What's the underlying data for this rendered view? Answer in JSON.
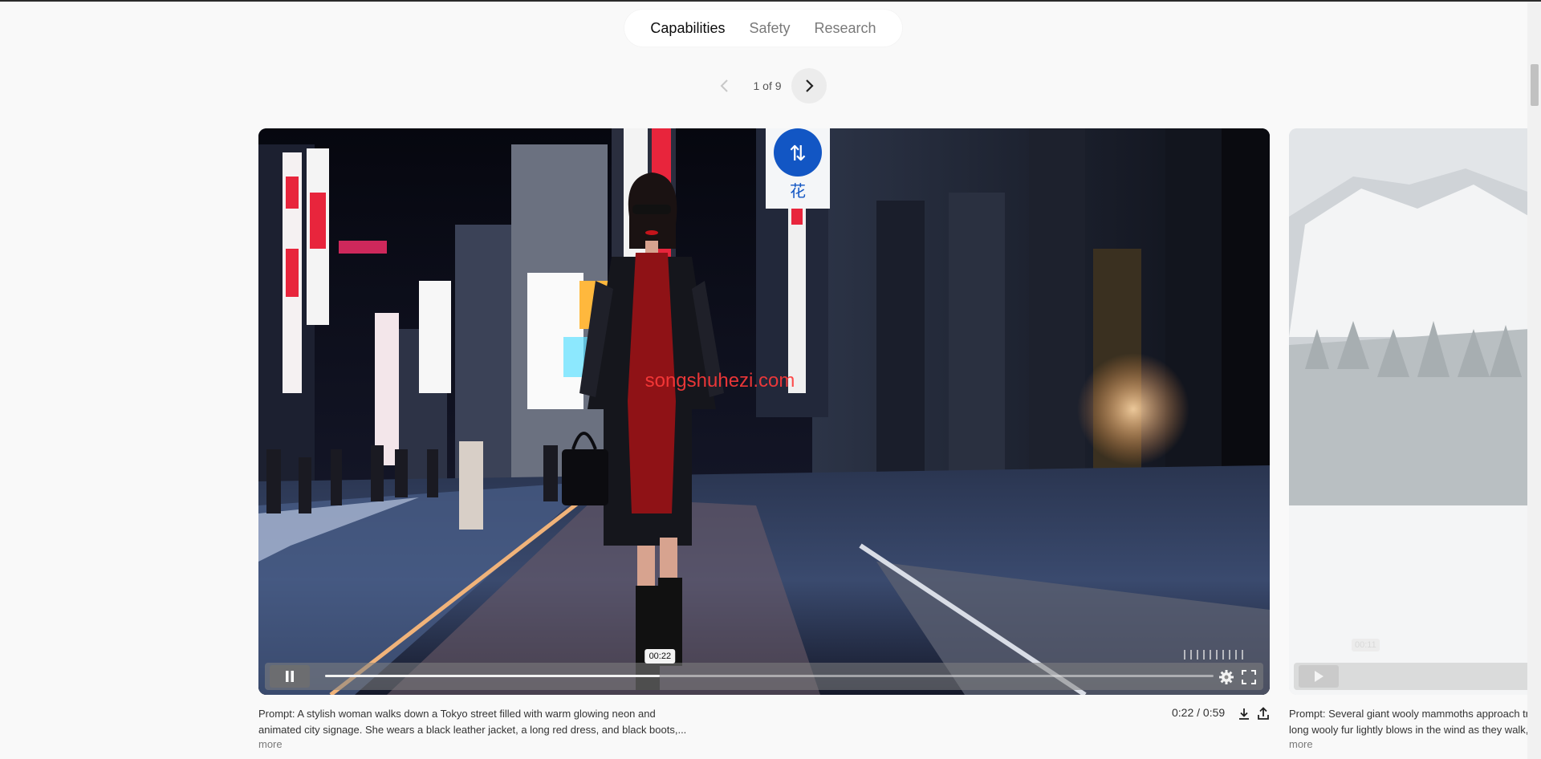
{
  "tabs": [
    {
      "label": "Capabilities",
      "active": true
    },
    {
      "label": "Safety",
      "active": false
    },
    {
      "label": "Research",
      "active": false
    }
  ],
  "pager": {
    "label": "1 of 9"
  },
  "main_video": {
    "tooltip_time": "00:22",
    "progress": 0.377,
    "duration_text": "0:22 / 0:59",
    "caption_line1": "Prompt: A stylish woman walks down a Tokyo street filled with warm glowing neon and",
    "caption_line2": "animated city signage. She wears a black leather jacket, a long red dress, and black boots,...",
    "more_label": "more",
    "sign_text": "花",
    "watermark": "songshuhezi.com"
  },
  "next_video": {
    "tooltip_time": "00:11",
    "caption_line1": "Prompt: Several giant wooly mammoths approach treading through a snowy meadow, their",
    "caption_line2": "long wooly fur lightly blows in the wind as they walk, snow covered trees and dramatic",
    "more_label": "more"
  },
  "colors": {
    "background": "#f9f9f9",
    "neon_red": "#e8253c",
    "dress_red": "#8f1216"
  }
}
